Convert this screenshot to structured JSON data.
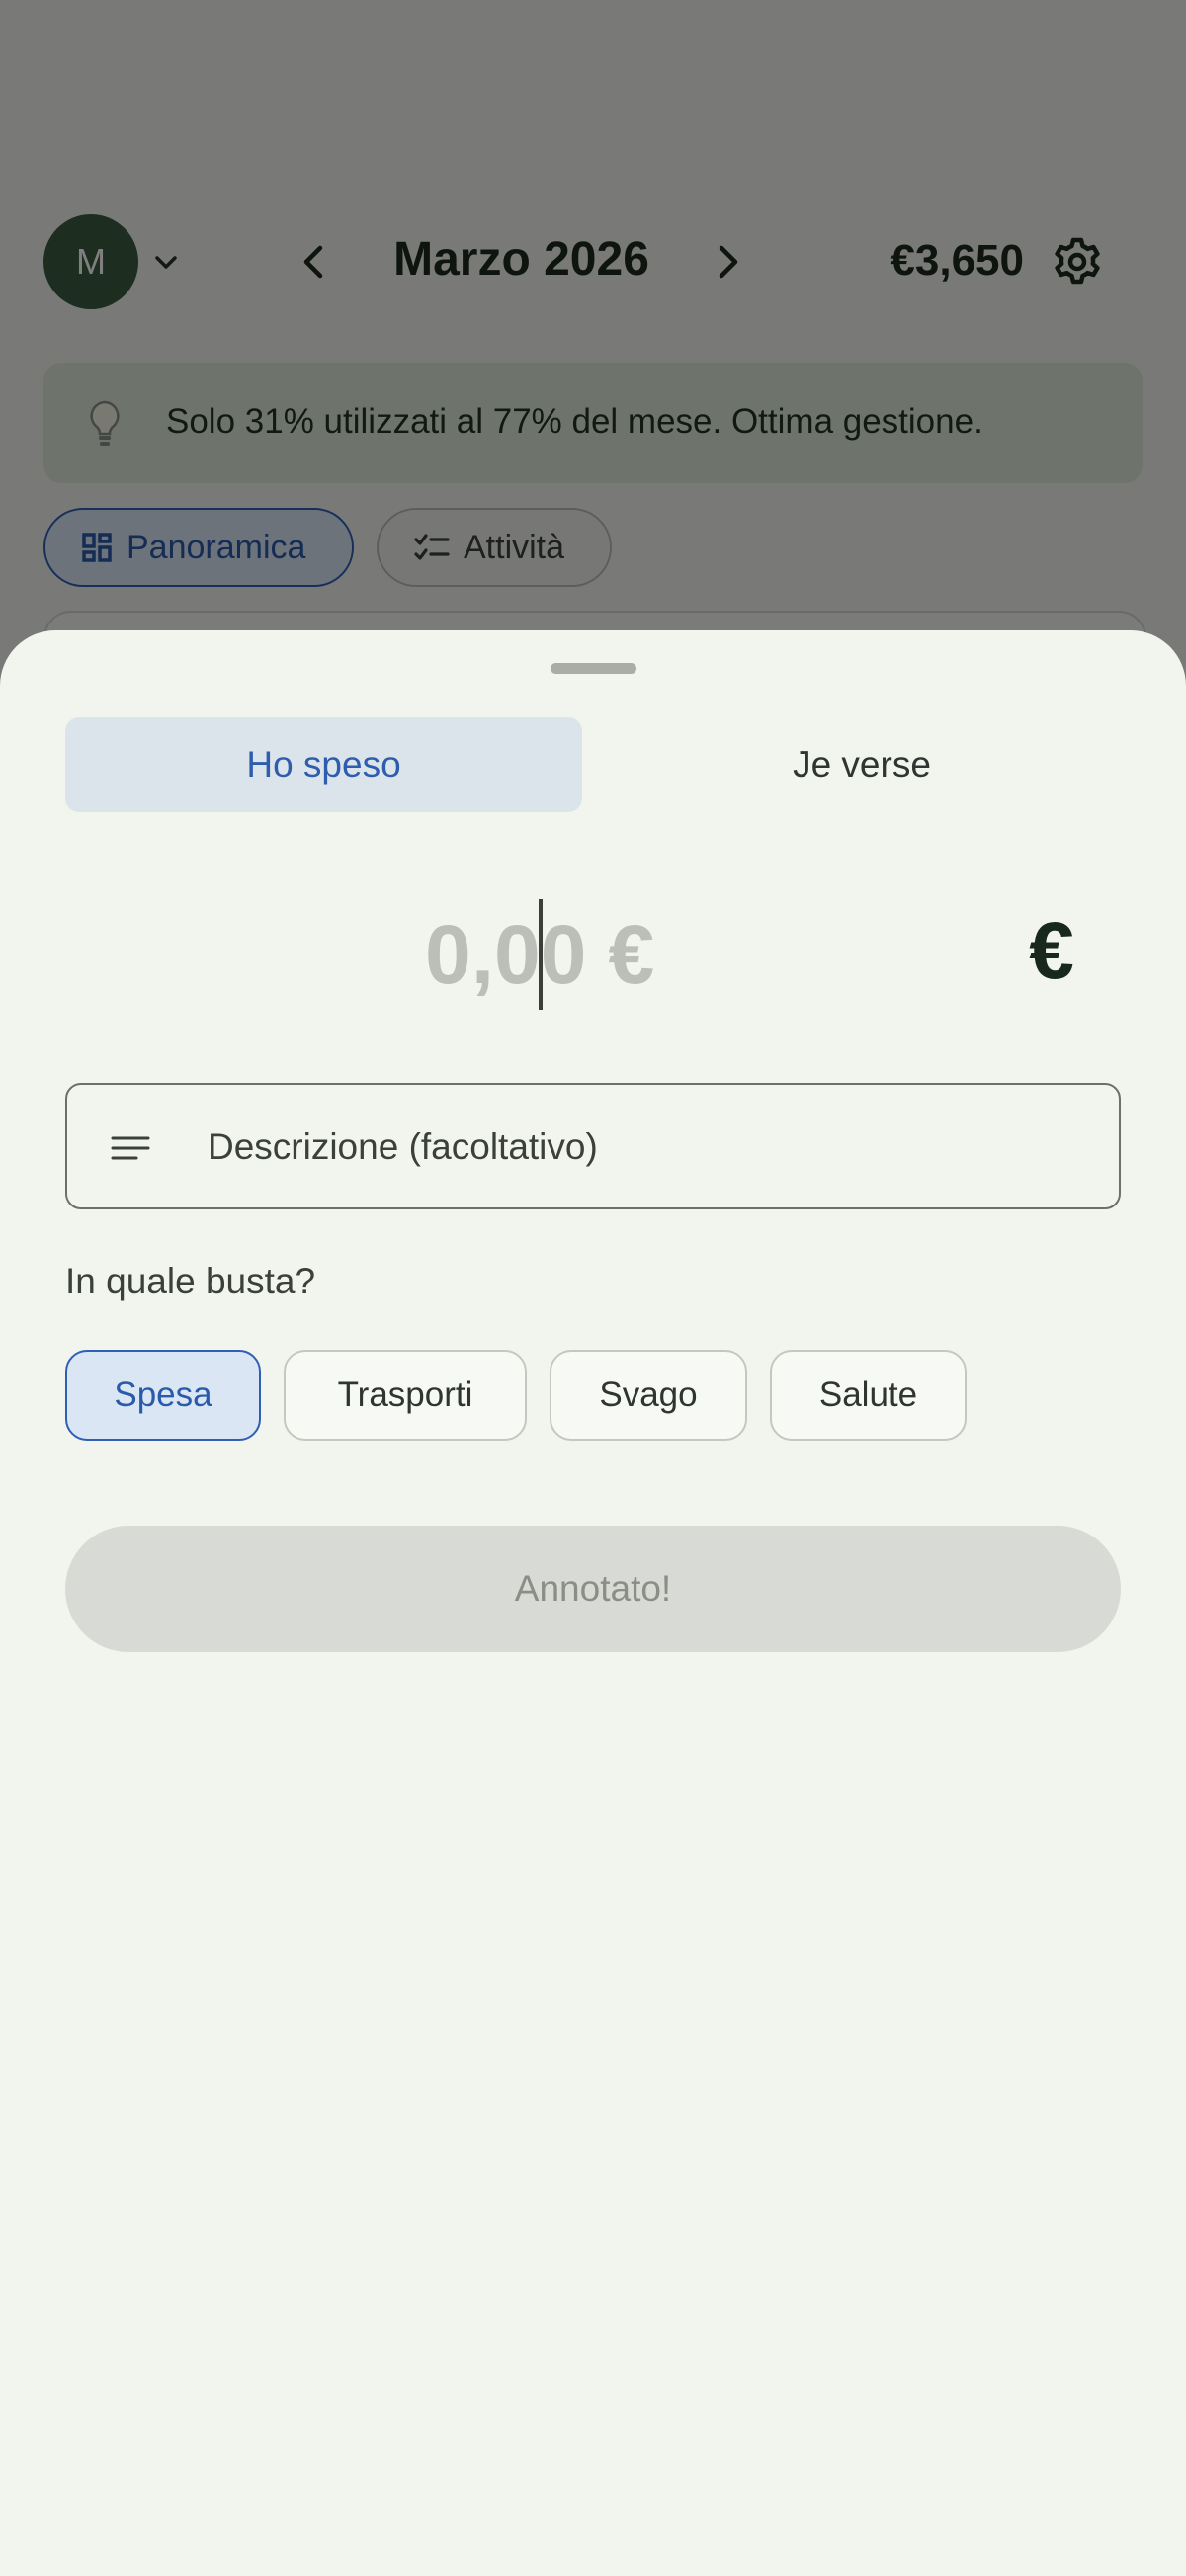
{
  "header": {
    "avatar_initial": "M",
    "month_title": "Marzo 2026",
    "budget_amount": "€3,650"
  },
  "tip": {
    "text": "Solo 31% utilizzati al 77% del mese. Ottima gestione."
  },
  "view_tabs": {
    "overview": "Panoramica",
    "activity": "Attività"
  },
  "sheet": {
    "toggle": {
      "spent": "Ho speso",
      "paid": "Je verse",
      "selected": "spent"
    },
    "amount": {
      "value_before_cursor": "0,0",
      "value_after_cursor": "0",
      "suffix": "€",
      "currency_symbol": "€"
    },
    "description": {
      "placeholder": "Descrizione (facoltativo)",
      "value": ""
    },
    "envelope_question": "In quale busta?",
    "envelopes": [
      {
        "label": "Spesa",
        "selected": true
      },
      {
        "label": "Trasporti",
        "selected": false
      },
      {
        "label": "Svago",
        "selected": false
      },
      {
        "label": "Salute",
        "selected": false
      }
    ],
    "submit_label": "Annotato!"
  },
  "colors": {
    "accent": "#2f5fb5",
    "accent_bg": "#dbe6f5",
    "sheet_bg": "#f2f4ee",
    "avatar_bg": "#3a5a3e",
    "disabled_button": "#d8dbd5"
  },
  "icons": {
    "avatar_caret": "chevron-down-icon",
    "prev_month": "chevron-left-icon",
    "next_month": "chevron-right-icon",
    "settings": "gear-icon",
    "tip": "lightbulb-icon",
    "overview": "dashboard-icon",
    "activity": "checklist-icon",
    "description": "notes-icon"
  }
}
